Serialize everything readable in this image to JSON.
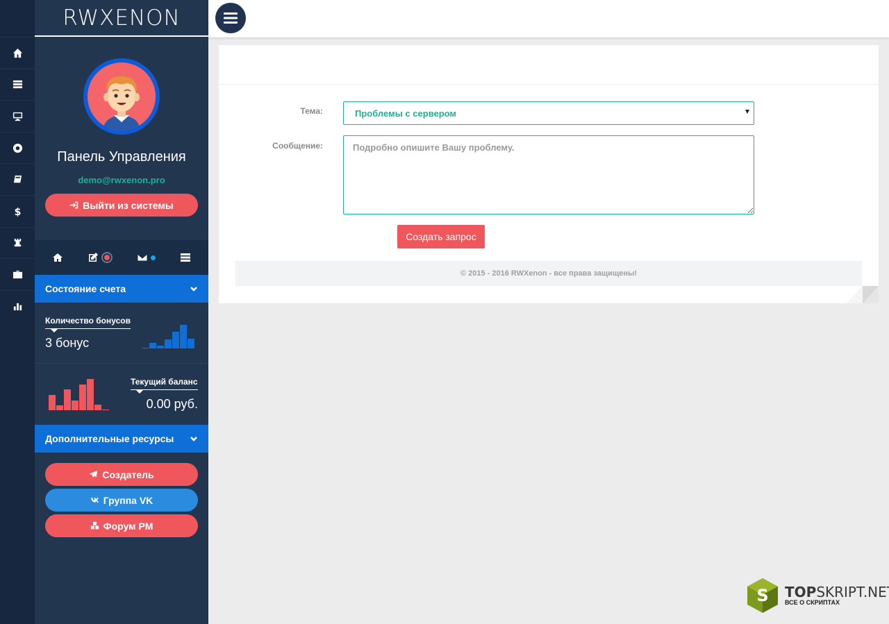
{
  "rail": {
    "icons": [
      "home-icon",
      "server-icon",
      "desktop-icon",
      "life-ring-icon",
      "book-icon",
      "dollar-icon",
      "chess-rook-icon",
      "briefcase-icon",
      "bar-chart-icon"
    ]
  },
  "brand": {
    "name": "RWXENON"
  },
  "profile": {
    "panel_title": "Панель Управления",
    "email": "demo@rwxenon.pro",
    "logout_label": "Выйти из системы"
  },
  "account": {
    "section_title": "Состояние счета",
    "bonus_label": "Количество бонусов",
    "bonus_value": "3 бонус",
    "balance_label": "Текущий баланс",
    "balance_value": "0.00 руб."
  },
  "resources": {
    "section_title": "Дополнительные ресурсы",
    "creator_label": "Создатель",
    "vk_label": "Группа VK",
    "forum_label": "Форум PM"
  },
  "form": {
    "topic_label": "Тема:",
    "topic_value": "Проблемы с сервером",
    "message_label": "Сообщение:",
    "message_placeholder": "Подробно опишите Вашу проблему.",
    "submit_label": "Создать запрос"
  },
  "footer": {
    "copyright": "© 2015 - 2016 RWXenon - все права защищены!"
  },
  "watermark": {
    "brand_a": "TOP",
    "brand_b": "SKRIPT.NET",
    "tagline": "ВСЕ О СКРИПТАХ"
  },
  "colors": {
    "accent_red": "#f0575c",
    "accent_teal": "#1bb394",
    "accent_blue": "#0f6fd8",
    "sidebar": "#223650",
    "rail": "#172740"
  }
}
